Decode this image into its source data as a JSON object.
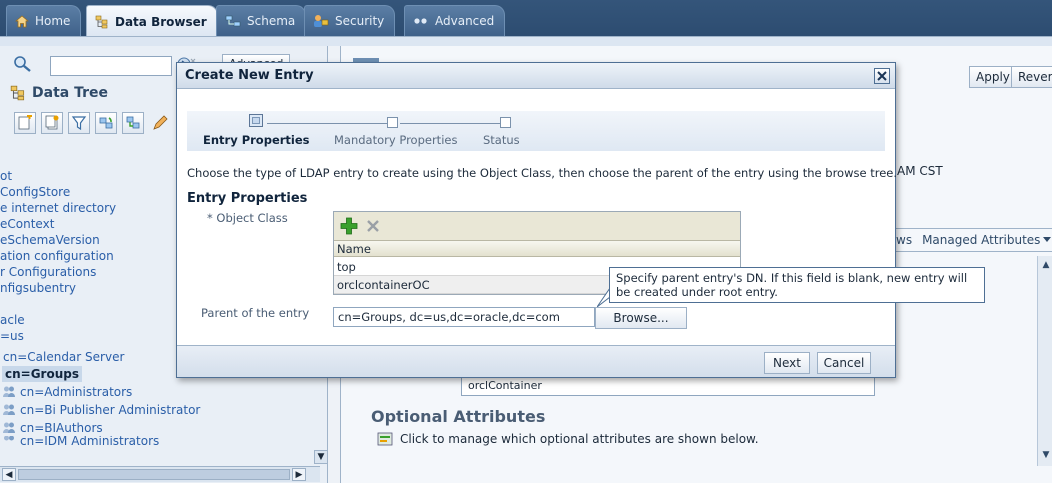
{
  "tabs": [
    {
      "label": "Home"
    },
    {
      "label": "Data Browser"
    },
    {
      "label": "Schema"
    },
    {
      "label": "Security"
    },
    {
      "label": "Advanced"
    }
  ],
  "left_panel": {
    "search": {
      "value": "",
      "advanced_label": "Advanced"
    },
    "tree_title": "Data Tree",
    "tree_items": [
      "ot",
      "ConfigStore",
      "e internet directory",
      "eContext",
      "eSchemaVersion",
      "ation configuration",
      "r Configurations",
      "nfigsubentry",
      "acle",
      "=us",
      "cn=Calendar Server",
      "cn=Groups",
      "cn=Administrators",
      "cn=Bi Publisher Administrator",
      "cn=BIAuthors",
      "cn=IDM Administrators"
    ]
  },
  "right_panel": {
    "apply_label": "Apply",
    "revert_label": "Revert",
    "timestamp_suffix": "AM CST",
    "tabs_fragment": "ws",
    "managed_attributes_label": "Managed Attributes",
    "object_class_value": "orclContainer",
    "optional_attributes_title": "Optional Attributes",
    "optional_attributes_hint": "Click to manage which optional attributes are shown below."
  },
  "dialog": {
    "title": "Create New Entry",
    "train": [
      {
        "label": "Entry Properties",
        "current": true
      },
      {
        "label": "Mandatory Properties",
        "current": false
      },
      {
        "label": "Status",
        "current": false
      }
    ],
    "instructions": "Choose the type of LDAP entry to create using the Object Class, then choose the parent of the entry using the browse tree.",
    "section_title": "Entry Properties",
    "object_class_label": "Object Class",
    "object_class_required": "*",
    "table": {
      "header": "Name",
      "rows": [
        "top",
        "orclcontainerOC"
      ]
    },
    "tooltip": "Specify parent entry's DN. If this field is blank, new entry will be created under root entry.",
    "parent_label": "Parent of the entry",
    "parent_value": "cn=Groups, dc=us,dc=oracle,dc=com",
    "browse_label": "Browse...",
    "next_label": "Next",
    "cancel_label": "Cancel"
  },
  "colors": {
    "tabbar": "#2b4a6e",
    "link": "#2a5ea8",
    "add_icon": "#3aa02d"
  }
}
